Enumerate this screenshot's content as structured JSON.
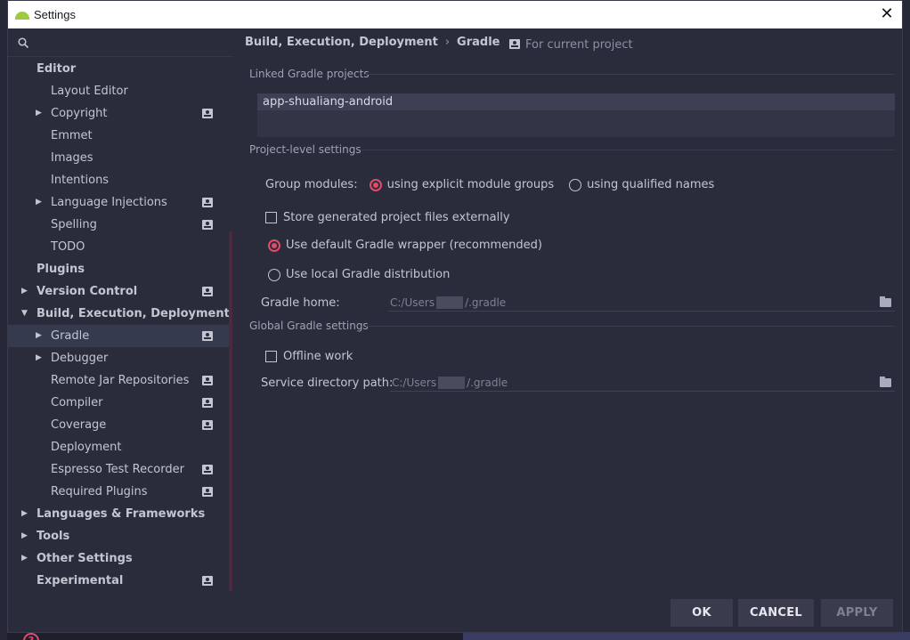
{
  "window": {
    "title": "Settings",
    "close_label": "✕"
  },
  "search": {
    "icon": "search-icon",
    "placeholder": ""
  },
  "sidebar": {
    "items": [
      {
        "label": "Editor",
        "level": 0,
        "bold": true,
        "arrow": "",
        "project": false,
        "selected": false
      },
      {
        "label": "Layout Editor",
        "level": 1,
        "bold": false,
        "arrow": "",
        "project": false,
        "selected": false
      },
      {
        "label": "Copyright",
        "level": 1,
        "bold": false,
        "arrow": "▶",
        "project": true,
        "selected": false
      },
      {
        "label": "Emmet",
        "level": 1,
        "bold": false,
        "arrow": "",
        "project": false,
        "selected": false
      },
      {
        "label": "Images",
        "level": 1,
        "bold": false,
        "arrow": "",
        "project": false,
        "selected": false
      },
      {
        "label": "Intentions",
        "level": 1,
        "bold": false,
        "arrow": "",
        "project": false,
        "selected": false
      },
      {
        "label": "Language Injections",
        "level": 1,
        "bold": false,
        "arrow": "▶",
        "project": true,
        "selected": false
      },
      {
        "label": "Spelling",
        "level": 1,
        "bold": false,
        "arrow": "",
        "project": true,
        "selected": false
      },
      {
        "label": "TODO",
        "level": 1,
        "bold": false,
        "arrow": "",
        "project": false,
        "selected": false
      },
      {
        "label": "Plugins",
        "level": 0,
        "bold": true,
        "arrow": "",
        "project": false,
        "selected": false
      },
      {
        "label": "Version Control",
        "level": 0,
        "bold": true,
        "arrow": "▶",
        "project": true,
        "selected": false
      },
      {
        "label": "Build, Execution, Deployment",
        "level": 0,
        "bold": true,
        "arrow": "▼",
        "project": false,
        "selected": false
      },
      {
        "label": "Gradle",
        "level": 1,
        "bold": false,
        "arrow": "▶",
        "project": true,
        "selected": true
      },
      {
        "label": "Debugger",
        "level": 1,
        "bold": false,
        "arrow": "▶",
        "project": false,
        "selected": false
      },
      {
        "label": "Remote Jar Repositories",
        "level": 1,
        "bold": false,
        "arrow": "",
        "project": true,
        "selected": false
      },
      {
        "label": "Compiler",
        "level": 1,
        "bold": false,
        "arrow": "",
        "project": true,
        "selected": false
      },
      {
        "label": "Coverage",
        "level": 1,
        "bold": false,
        "arrow": "",
        "project": true,
        "selected": false
      },
      {
        "label": "Deployment",
        "level": 1,
        "bold": false,
        "arrow": "",
        "project": false,
        "selected": false
      },
      {
        "label": "Espresso Test Recorder",
        "level": 1,
        "bold": false,
        "arrow": "",
        "project": true,
        "selected": false
      },
      {
        "label": "Required Plugins",
        "level": 1,
        "bold": false,
        "arrow": "",
        "project": true,
        "selected": false
      },
      {
        "label": "Languages & Frameworks",
        "level": 0,
        "bold": true,
        "arrow": "▶",
        "project": false,
        "selected": false
      },
      {
        "label": "Tools",
        "level": 0,
        "bold": true,
        "arrow": "▶",
        "project": false,
        "selected": false
      },
      {
        "label": "Other Settings",
        "level": 0,
        "bold": true,
        "arrow": "▶",
        "project": false,
        "selected": false
      },
      {
        "label": "Experimental",
        "level": 0,
        "bold": true,
        "arrow": "",
        "project": true,
        "selected": false
      }
    ],
    "help_label": "?"
  },
  "main": {
    "breadcrumb": {
      "parent": "Build, Execution, Deployment",
      "separator": "›",
      "current": "Gradle"
    },
    "scope_label": "For current project",
    "linked_title": "Linked Gradle projects",
    "linked_projects": [
      "app-shualiang-android"
    ],
    "project_level_title": "Project-level settings",
    "group_modules_label": "Group modules:",
    "group_option_explicit": "using explicit module groups",
    "group_option_qualified": "using qualified names",
    "store_external_label": "Store generated project files externally",
    "default_wrapper_label": "Use default Gradle wrapper (recommended)",
    "local_distribution_label": "Use local Gradle distribution",
    "gradle_home_label": "Gradle home:",
    "gradle_home_prefix": "C:/Users",
    "gradle_home_suffix": "/.gradle",
    "global_title": "Global Gradle settings",
    "offline_label": "Offline work",
    "service_dir_label": "Service directory path:",
    "service_dir_prefix": "C:/Users",
    "service_dir_suffix": "/.gradle"
  },
  "buttons": {
    "ok": "OK",
    "cancel": "CANCEL",
    "apply": "APPLY"
  },
  "colors": {
    "accent": "#e04d6a",
    "panel": "#2a2c3b",
    "selection": "#363a4f"
  }
}
